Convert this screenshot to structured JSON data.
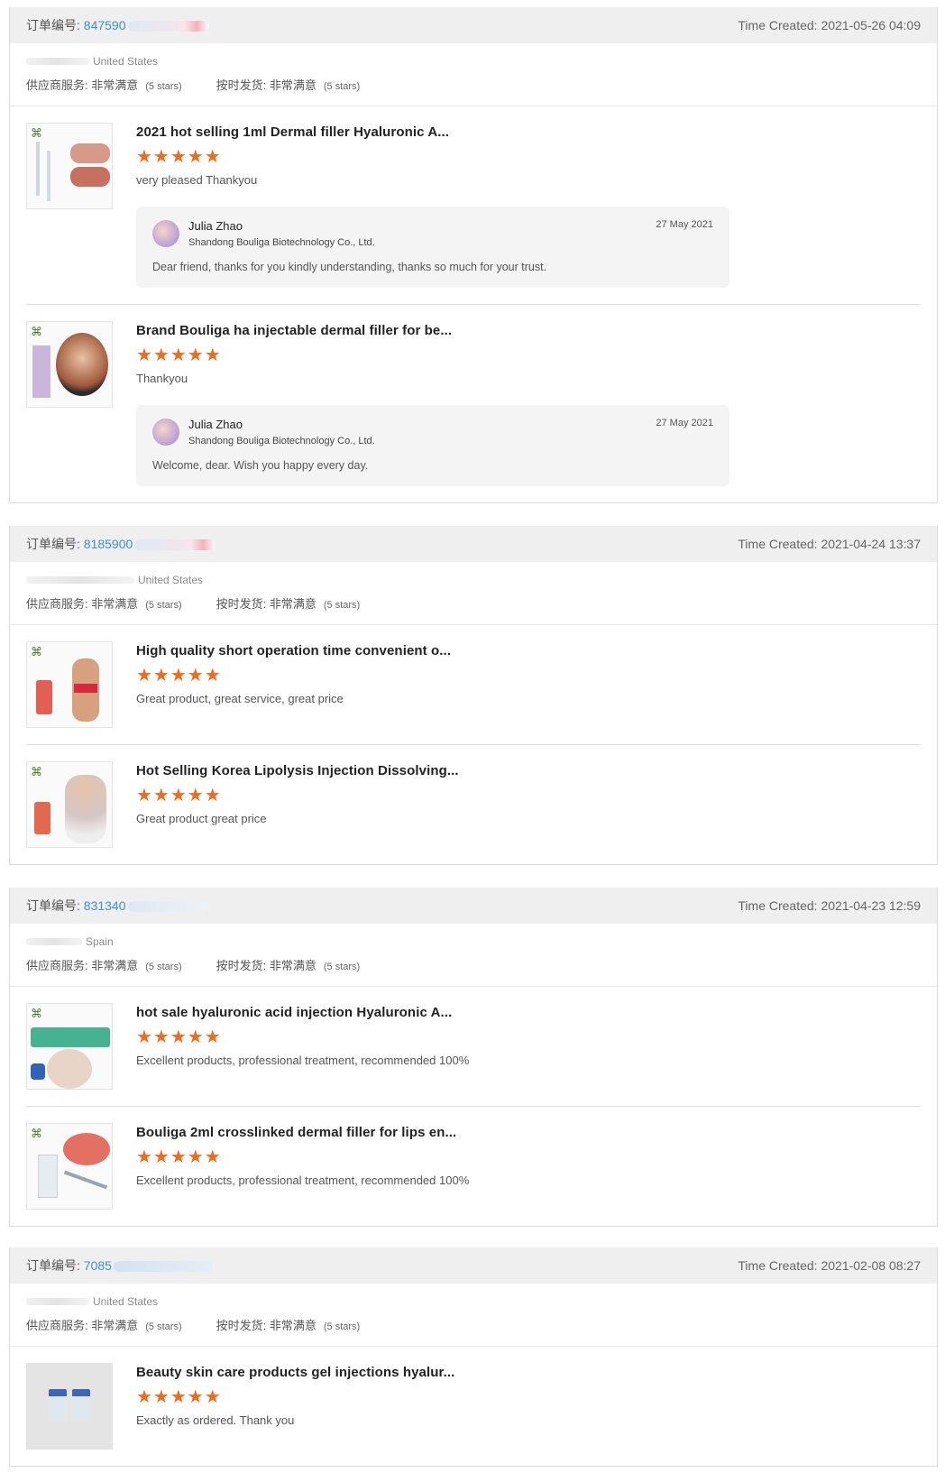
{
  "orders": [
    {
      "order_label": "订单编号:",
      "order_number": "847590",
      "time_created": "Time Created: 2021-05-26 04:09",
      "buyer_location": "United States",
      "supplier_service_label": "供应商服务:",
      "supplier_service_value": "非常满意",
      "supplier_service_stars": "(5 stars)",
      "on_time_label": "按时发货:",
      "on_time_value": "非常满意",
      "on_time_stars": "(5 stars)",
      "reviews": [
        {
          "title": "2021 hot selling 1ml Dermal filler Hyaluronic A...",
          "rating": 5,
          "comment": "very pleased Thankyou",
          "reply": {
            "name": "Julia Zhao",
            "company": "Shandong Bouliga Biotechnology Co., Ltd.",
            "date": "27 May 2021",
            "message": "Dear friend, thanks for you kindly understanding, thanks so much for your trust."
          }
        },
        {
          "title": "Brand Bouliga ha injectable dermal filler for be...",
          "rating": 5,
          "comment": "Thankyou",
          "reply": {
            "name": "Julia Zhao",
            "company": "Shandong Bouliga Biotechnology Co., Ltd.",
            "date": "27 May 2021",
            "message": "Welcome, dear. Wish you happy every day."
          }
        }
      ]
    },
    {
      "order_label": "订单编号:",
      "order_number": "8185900",
      "time_created": "Time Created: 2021-04-24 13:37",
      "buyer_location": "United States",
      "supplier_service_label": "供应商服务:",
      "supplier_service_value": "非常满意",
      "supplier_service_stars": "(5 stars)",
      "on_time_label": "按时发货:",
      "on_time_value": "非常满意",
      "on_time_stars": "(5 stars)",
      "reviews": [
        {
          "title": "High quality short operation time convenient o...",
          "rating": 5,
          "comment": "Great product, great service, great price"
        },
        {
          "title": "Hot Selling Korea Lipolysis Injection Dissolving...",
          "rating": 5,
          "comment": "Great product great price"
        }
      ]
    },
    {
      "order_label": "订单编号:",
      "order_number": "831340",
      "time_created": "Time Created: 2021-04-23 12:59",
      "buyer_location": "Spain",
      "supplier_service_label": "供应商服务:",
      "supplier_service_value": "非常满意",
      "supplier_service_stars": "(5 stars)",
      "on_time_label": "按时发货:",
      "on_time_value": "非常满意",
      "on_time_stars": "(5 stars)",
      "reviews": [
        {
          "title": "hot sale hyaluronic acid injection Hyaluronic A...",
          "rating": 5,
          "comment": "Excellent products, professional treatment, recommended 100%"
        },
        {
          "title": "Bouliga 2ml crosslinked dermal filler for lips en...",
          "rating": 5,
          "comment": "Excellent products, professional treatment, recommended 100%"
        }
      ]
    },
    {
      "order_label": "订单编号:",
      "order_number": "7085",
      "time_created": "Time Created: 2021-02-08 08:27",
      "buyer_location": "United States",
      "supplier_service_label": "供应商服务:",
      "supplier_service_value": "非常满意",
      "supplier_service_stars": "(5 stars)",
      "on_time_label": "按时发货:",
      "on_time_value": "非常满意",
      "on_time_stars": "(5 stars)",
      "reviews": [
        {
          "title": "Beauty skin care products gel injections hyalur...",
          "rating": 5,
          "comment": "Exactly as ordered.  Thank you"
        }
      ]
    }
  ],
  "colors": {
    "accent_link": "#3d8fd6",
    "star": "#f26a1b",
    "header_bg": "#efefef"
  },
  "star_glyph": "★★★★★"
}
